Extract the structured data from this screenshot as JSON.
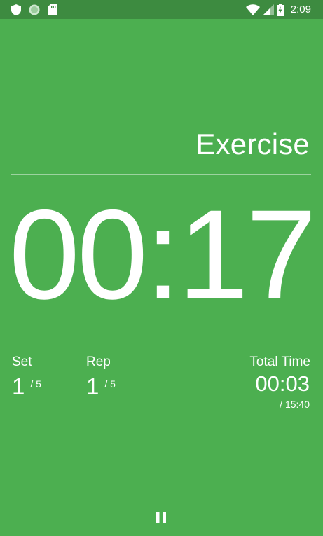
{
  "status_bar": {
    "time": "2:09",
    "left_icons": [
      "shield-icon",
      "circle-indicator-icon",
      "sd-card-icon"
    ],
    "right_icons": [
      "wifi-icon",
      "cell-signal-icon",
      "battery-charging-icon"
    ]
  },
  "workout": {
    "phase_title": "Exercise",
    "timer": "00:17"
  },
  "stats": {
    "set": {
      "label": "Set",
      "current": "1",
      "total": "/ 5"
    },
    "rep": {
      "label": "Rep",
      "current": "1",
      "total": "/ 5"
    },
    "total_time": {
      "label": "Total Time",
      "elapsed": "00:03",
      "total": "/ 15:40"
    }
  },
  "controls": {
    "pause_icon": "pause-icon"
  },
  "colors": {
    "background": "#4caf50",
    "status_bar": "#3d8b40",
    "text": "#ffffff"
  }
}
